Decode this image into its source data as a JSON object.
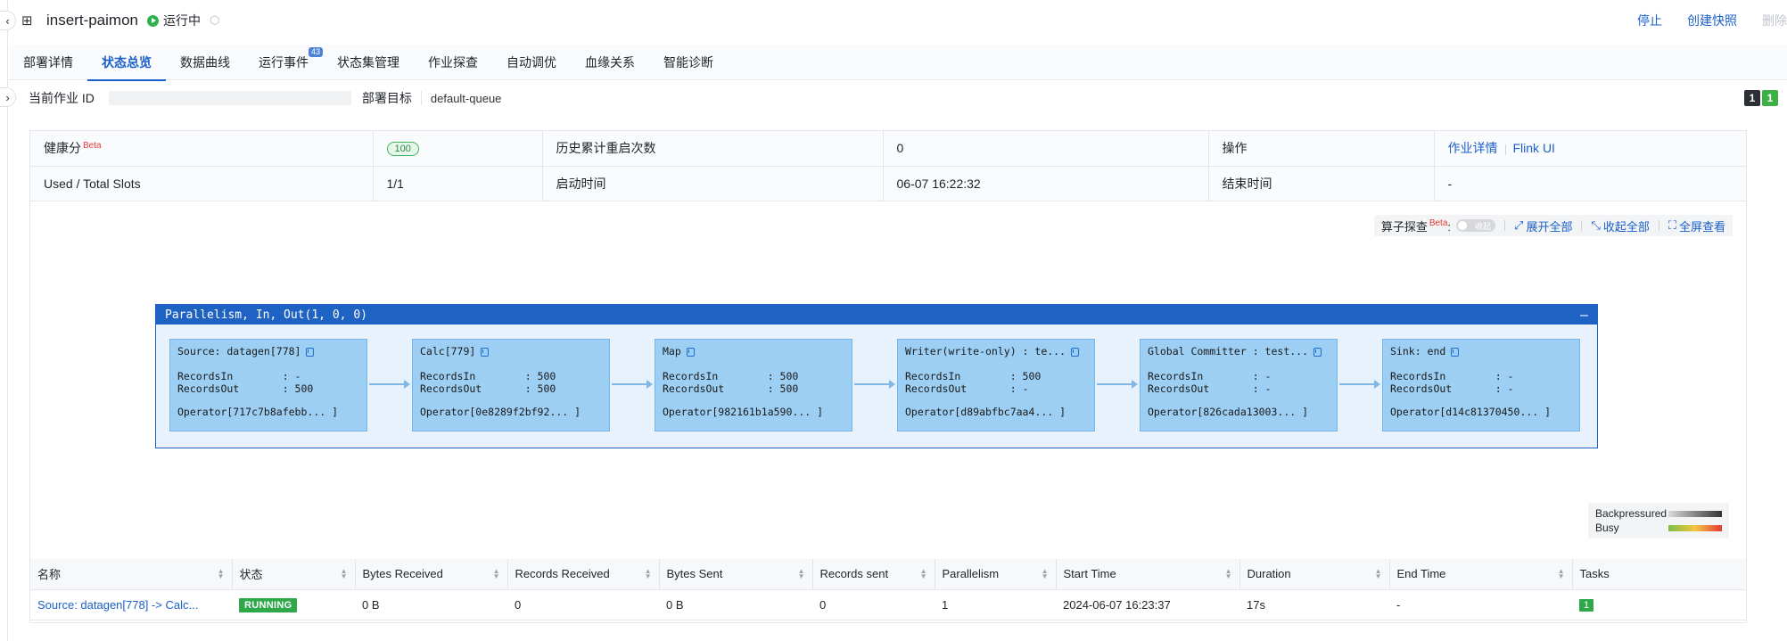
{
  "header": {
    "title": "insert-paimon",
    "status": "运行中",
    "actions": {
      "stop": "停止",
      "snapshot": "创建快照",
      "delete": "删除"
    }
  },
  "tabs": [
    {
      "label": "部署详情"
    },
    {
      "label": "状态总览",
      "active": true
    },
    {
      "label": "数据曲线"
    },
    {
      "label": "运行事件",
      "badge": "43"
    },
    {
      "label": "状态集管理"
    },
    {
      "label": "作业探查"
    },
    {
      "label": "自动调优"
    },
    {
      "label": "血缘关系"
    },
    {
      "label": "智能诊断"
    }
  ],
  "info": {
    "job_id_label": "当前作业 ID",
    "target_label": "部署目标",
    "target_value": "default-queue",
    "counter_a": "1",
    "counter_b": "1"
  },
  "summary": {
    "health_label": "健康分",
    "beta": "Beta",
    "health_value": "100",
    "restarts_label": "历史累计重启次数",
    "restarts_value": "0",
    "ops_label": "操作",
    "job_detail_link": "作业详情",
    "flink_ui_link": "Flink UI",
    "slots_label": "Used / Total Slots",
    "slots_value": "1/1",
    "start_label": "启动时间",
    "start_value": "06-07 16:22:32",
    "end_label": "结束时间",
    "end_value": "-"
  },
  "toolbar": {
    "probe_label": "算子探查",
    "beta": "Beta",
    "toggle_text": "收起",
    "expand_all": "展开全部",
    "collapse_all": "收起全部",
    "fullscreen": "全屏查看"
  },
  "graph": {
    "header": "Parallelism, In, Out(1, 0, 0)",
    "nodes": [
      {
        "name": "Source: datagen[778]",
        "in": "RecordsIn        : -",
        "out": "RecordsOut       : 500",
        "op": "Operator[717c7b8afebb... ]"
      },
      {
        "name": "Calc[779]",
        "in": "RecordsIn        : 500",
        "out": "RecordsOut       : 500",
        "op": "Operator[0e8289f2bf92... ]"
      },
      {
        "name": "Map",
        "in": "RecordsIn        : 500",
        "out": "RecordsOut       : 500",
        "op": "Operator[982161b1a590... ]"
      },
      {
        "name": "Writer(write-only) : te...",
        "in": "RecordsIn        : 500",
        "out": "RecordsOut       : -",
        "op": "Operator[d89abfbc7aa4... ]"
      },
      {
        "name": "Global Committer : test...",
        "in": "RecordsIn        : -",
        "out": "RecordsOut       : -",
        "op": "Operator[826cada13003... ]"
      },
      {
        "name": "Sink: end",
        "in": "RecordsIn        : -",
        "out": "RecordsOut       : -",
        "op": "Operator[d14c81370450... ]"
      }
    ]
  },
  "legend": {
    "backpressured": "Backpressured",
    "busy": "Busy"
  },
  "vertices": {
    "columns": [
      "名称",
      "状态",
      "Bytes Received",
      "Records Received",
      "Bytes Sent",
      "Records sent",
      "Parallelism",
      "Start Time",
      "Duration",
      "End Time",
      "Tasks"
    ],
    "rows": [
      {
        "name": "Source: datagen[778] -> Calc...",
        "status": "RUNNING",
        "bytes_received": "0 B",
        "records_received": "0",
        "bytes_sent": "0 B",
        "records_sent": "0",
        "parallelism": "1",
        "start_time": "2024-06-07 16:23:37",
        "duration": "17s",
        "end_time": "-",
        "tasks": "1"
      }
    ]
  },
  "colors": {
    "accent": "#1b5fc9",
    "running": "#2fa84a",
    "graph_header": "#1e62c4",
    "node_fill": "#9ccff3"
  }
}
